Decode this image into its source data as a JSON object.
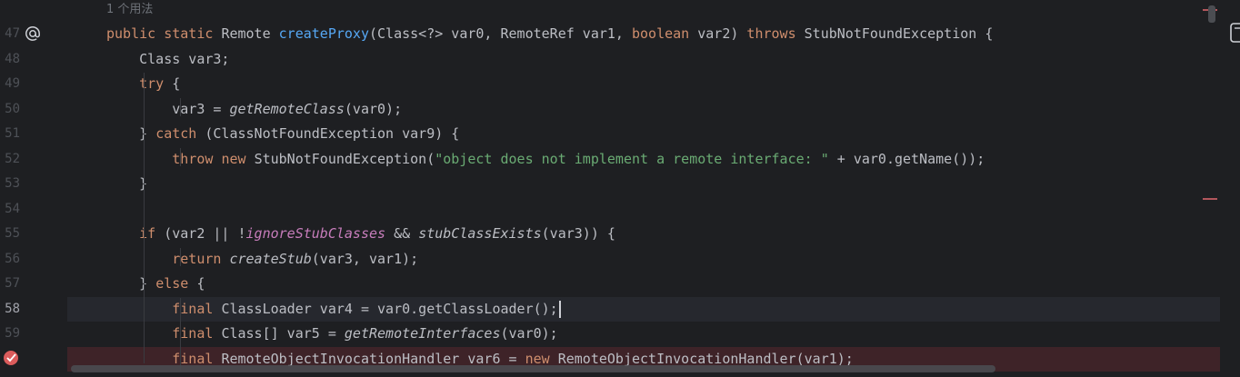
{
  "editor": {
    "usage_hint": "1 个用法",
    "current_line": 58,
    "breakpoint_line": 60,
    "lines": [
      {
        "num": "47",
        "parts": [
          [
            "kw",
            "public "
          ],
          [
            "kw",
            "static "
          ],
          [
            "p",
            "Remote "
          ],
          [
            "fn",
            "createProxy"
          ],
          [
            "p",
            "(Class<?> var0, RemoteRef var1, "
          ],
          [
            "kw",
            "boolean "
          ],
          [
            "p",
            "var2) "
          ],
          [
            "kw",
            "throws "
          ],
          [
            "p",
            "StubNotFoundException {"
          ]
        ]
      },
      {
        "num": "48",
        "parts": [
          [
            "p",
            "    Class var3;"
          ]
        ]
      },
      {
        "num": "49",
        "parts": [
          [
            "p",
            "    "
          ],
          [
            "kw",
            "try "
          ],
          [
            "p",
            "{"
          ]
        ]
      },
      {
        "num": "50",
        "parts": [
          [
            "p",
            "        var3 = "
          ],
          [
            "ital",
            "getRemoteClass"
          ],
          [
            "p",
            "(var0);"
          ]
        ]
      },
      {
        "num": "51",
        "parts": [
          [
            "p",
            "    } "
          ],
          [
            "kw",
            "catch "
          ],
          [
            "p",
            "(ClassNotFoundException var9) {"
          ]
        ]
      },
      {
        "num": "52",
        "parts": [
          [
            "p",
            "        "
          ],
          [
            "kw",
            "throw "
          ],
          [
            "kw",
            "new "
          ],
          [
            "p",
            "StubNotFoundException("
          ],
          [
            "str",
            "\"object does not implement a remote interface: \""
          ],
          [
            "p",
            " + var0.getName());"
          ]
        ]
      },
      {
        "num": "53",
        "parts": [
          [
            "p",
            "    }"
          ]
        ]
      },
      {
        "num": "54",
        "parts": []
      },
      {
        "num": "55",
        "parts": [
          [
            "p",
            "    "
          ],
          [
            "kw",
            "if "
          ],
          [
            "p",
            "(var2 || !"
          ],
          [
            "field",
            "ignoreStubClasses"
          ],
          [
            "p",
            " && "
          ],
          [
            "ital",
            "stubClassExists"
          ],
          [
            "p",
            "(var3)) {"
          ]
        ]
      },
      {
        "num": "56",
        "parts": [
          [
            "p",
            "        "
          ],
          [
            "kw",
            "return "
          ],
          [
            "ital",
            "createStub"
          ],
          [
            "p",
            "(var3, var1);"
          ]
        ]
      },
      {
        "num": "57",
        "parts": [
          [
            "p",
            "    } "
          ],
          [
            "kw",
            "else "
          ],
          [
            "p",
            "{"
          ]
        ]
      },
      {
        "num": "58",
        "parts": [
          [
            "p",
            "        "
          ],
          [
            "kw",
            "final "
          ],
          [
            "p",
            "ClassLoader var4 = var0.getClassLoader();"
          ],
          [
            "caret",
            ""
          ]
        ]
      },
      {
        "num": "59",
        "parts": [
          [
            "p",
            "        "
          ],
          [
            "kw",
            "final "
          ],
          [
            "p",
            "Class[] var5 = "
          ],
          [
            "ital",
            "getRemoteInterfaces"
          ],
          [
            "p",
            "(var0);"
          ]
        ]
      },
      {
        "num": "",
        "parts": [
          [
            "p",
            "        "
          ],
          [
            "kw",
            "final "
          ],
          [
            "p",
            "RemoteObjectInvocationHandler var6 = "
          ],
          [
            "kw",
            "new "
          ],
          [
            "p",
            "RemoteObjectInvocationHandler(var1);"
          ]
        ]
      }
    ]
  },
  "icons": {
    "override": "at-sign-icon",
    "breakpoint": "breakpoint-check-icon",
    "document": "document-icon"
  },
  "colors": {
    "background": "#1e1f22",
    "keyword": "#cf8e6d",
    "function": "#56a8f5",
    "string": "#6aab73",
    "field": "#c77dbb",
    "breakpoint_row": "#3e2328",
    "current_row": "#26282e"
  }
}
